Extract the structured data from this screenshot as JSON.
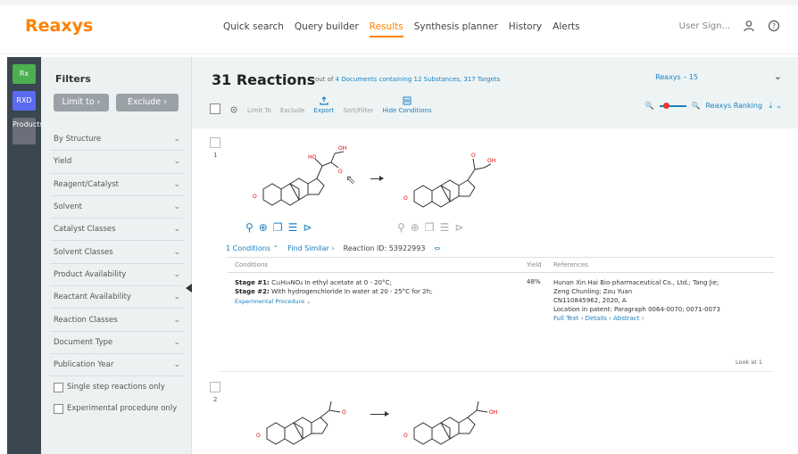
{
  "app": {
    "logo": "Reaxys"
  },
  "nav": {
    "items": [
      "Quick search",
      "Query builder",
      "Results",
      "Synthesis planner",
      "History",
      "Alerts"
    ],
    "active_index": 2
  },
  "header_right": {
    "user_label": "User Sign..."
  },
  "rail": {
    "tile1": "Rx",
    "tile2": "RXD",
    "tile3": "Products"
  },
  "filters": {
    "title": "Filters",
    "limit_to": "Limit to",
    "exclude": "Exclude",
    "items": [
      "By Structure",
      "Yield",
      "Reagent/Catalyst",
      "Solvent",
      "Catalyst Classes",
      "Solvent Classes",
      "Product Availability",
      "Reactant Availability",
      "Reaction Classes",
      "Document Type",
      "Publication Year"
    ],
    "checks": [
      "Single step reactions only",
      "Experimental procedure only"
    ]
  },
  "results": {
    "count": "31 Reactions",
    "subtitle_prefix": "out of",
    "subtitle_links": "4 Documents containing 12 Substances, 317 Targets",
    "right_label": "Reaxys – 15",
    "tools": [
      "Limit To",
      "Exclude",
      "Export",
      "Sort/Filter",
      "Hide Conditions"
    ],
    "sort_label": "Reaxys Ranking"
  },
  "reaction1": {
    "index": "1",
    "conditions_label": "1 Conditions",
    "find_similar": "Find Similar",
    "reaction_id": "Reaction ID: 53922993",
    "col_conditions": "Conditions",
    "col_yield": "Yield",
    "col_references": "References",
    "stage1_label": "Stage #1:",
    "stage1_text": "C₂₂H₂₉NO₄ In ethyl acetate at 0 - 20°C;",
    "stage2_label": "Stage #2:",
    "stage2_text": "With hydrogenchloride In water at 20 - 25°C for 2h;",
    "experimental": "Experimental Procedure",
    "yield": "48%",
    "ref_line1": "Hunan Xin Hai Bio-pharmaceutical Co., Ltd.; Tang Jie;",
    "ref_line2": "Zeng Chunling; Zou Yuan",
    "ref_line3": "CN110845962, 2020, A",
    "ref_line4": "Location in patent: Paragraph 0064-0070; 0071-0073",
    "ref_links": "Full Text  ›   Details  ›   Abstract  ›",
    "look_at": "Look at 1"
  },
  "reaction2": {
    "index": "2"
  }
}
